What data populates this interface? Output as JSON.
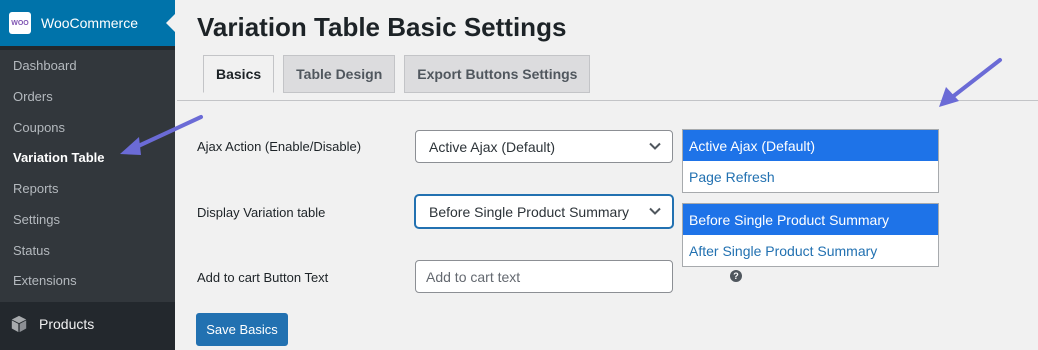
{
  "sidebar": {
    "brand": {
      "logo_text": "WOO",
      "title": "WooCommerce"
    },
    "items": [
      {
        "label": "Dashboard",
        "current": false
      },
      {
        "label": "Orders",
        "current": false
      },
      {
        "label": "Coupons",
        "current": false
      },
      {
        "label": "Variation Table",
        "current": true
      },
      {
        "label": "Reports",
        "current": false
      },
      {
        "label": "Settings",
        "current": false
      },
      {
        "label": "Status",
        "current": false
      },
      {
        "label": "Extensions",
        "current": false
      }
    ],
    "products_label": "Products",
    "products_icon": "box-icon"
  },
  "page": {
    "title": "Variation Table Basic Settings",
    "tabs": [
      {
        "label": "Basics",
        "active": true
      },
      {
        "label": "Table Design",
        "active": false
      },
      {
        "label": "Export Buttons Settings",
        "active": false
      }
    ]
  },
  "form": {
    "ajax_action": {
      "label": "Ajax Action (Enable/Disable)",
      "value": "Active Ajax (Default)",
      "options": [
        "Active Ajax (Default)",
        "Page Refresh"
      ]
    },
    "display_table": {
      "label": "Display Variation table",
      "value": "Before Single Product Summary",
      "options": [
        "Before Single Product Summary",
        "After Single Product Summary"
      ]
    },
    "cart_button_text": {
      "label": "Add to cart Button Text",
      "value": "",
      "placeholder": "Add to cart text",
      "help_icon": "?"
    },
    "save_label": "Save Basics"
  },
  "colors": {
    "sidebar_bg": "#23282d",
    "submenu_bg": "#32373c",
    "brand_blue": "#0073aa",
    "button_blue": "#2271b1",
    "option_selected": "#1e73e8",
    "annotation_arrow": "#6b6bd6"
  }
}
